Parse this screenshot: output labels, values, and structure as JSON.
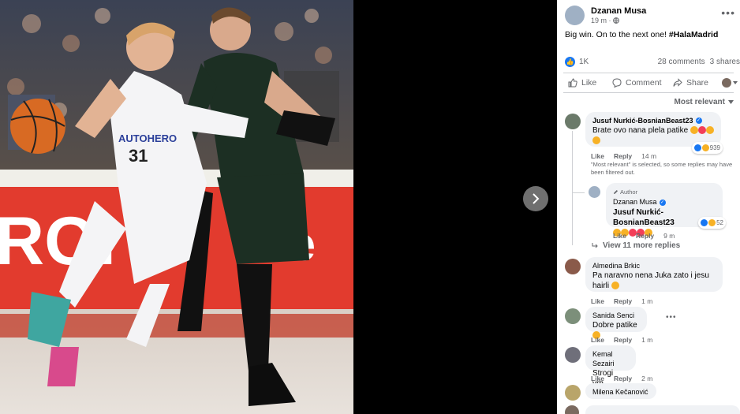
{
  "post": {
    "author": "Dzanan Musa",
    "time": "19 m ·",
    "privacy_icon": "globe-icon",
    "text": "Big win. On to the next one! ",
    "hashtag": "#HalaMadrid",
    "reactions_count": "1K",
    "comments_count": "28 comments",
    "shares_count": "3 shares"
  },
  "photo": {
    "jersey_sponsor": "AUTOHERO",
    "jersey_number": "31",
    "ad_text_left": "ROI",
    "ad_text_right": "de"
  },
  "actions": {
    "like": "Like",
    "comment": "Comment",
    "share": "Share"
  },
  "sort": {
    "label": "Most relevant"
  },
  "comments": [
    {
      "name": "Jusuf Nurkić-BosnianBeast23",
      "verified": true,
      "text": "Brate ovo nana plela patike",
      "like": "Like",
      "reply": "Reply",
      "time": "14 m",
      "reaction_count": "939",
      "note": "\"Most relevant\" is selected, so some replies may have been filtered out."
    },
    {
      "label": "Author",
      "name": "Dzanan Musa",
      "verified": true,
      "mention": "Jusuf Nurkić-BosnianBeast23",
      "like": "Like",
      "reply": "Reply",
      "time": "9 m",
      "reaction_count": "52"
    },
    {
      "more_replies": "View 11 more replies"
    },
    {
      "name": "Almedina Brkic",
      "text": "Pa naravno nena Juka zato i jesu hairli",
      "like": "Like",
      "reply": "Reply",
      "time": "1 m"
    },
    {
      "name": "Sanida Senci",
      "text": "Dobre patike",
      "like": "Like",
      "reply": "Reply",
      "time": "1 m"
    },
    {
      "name": "Kemal Sezairi",
      "text": "Strogi vrh...",
      "like": "Like",
      "reply": "Reply",
      "time": "2 m"
    },
    {
      "name": "Milena Kečanović"
    }
  ],
  "colors": {
    "accent": "#1877f2",
    "madrid_white": "#f4f4f6",
    "opponent_green": "#1f3f2a"
  }
}
